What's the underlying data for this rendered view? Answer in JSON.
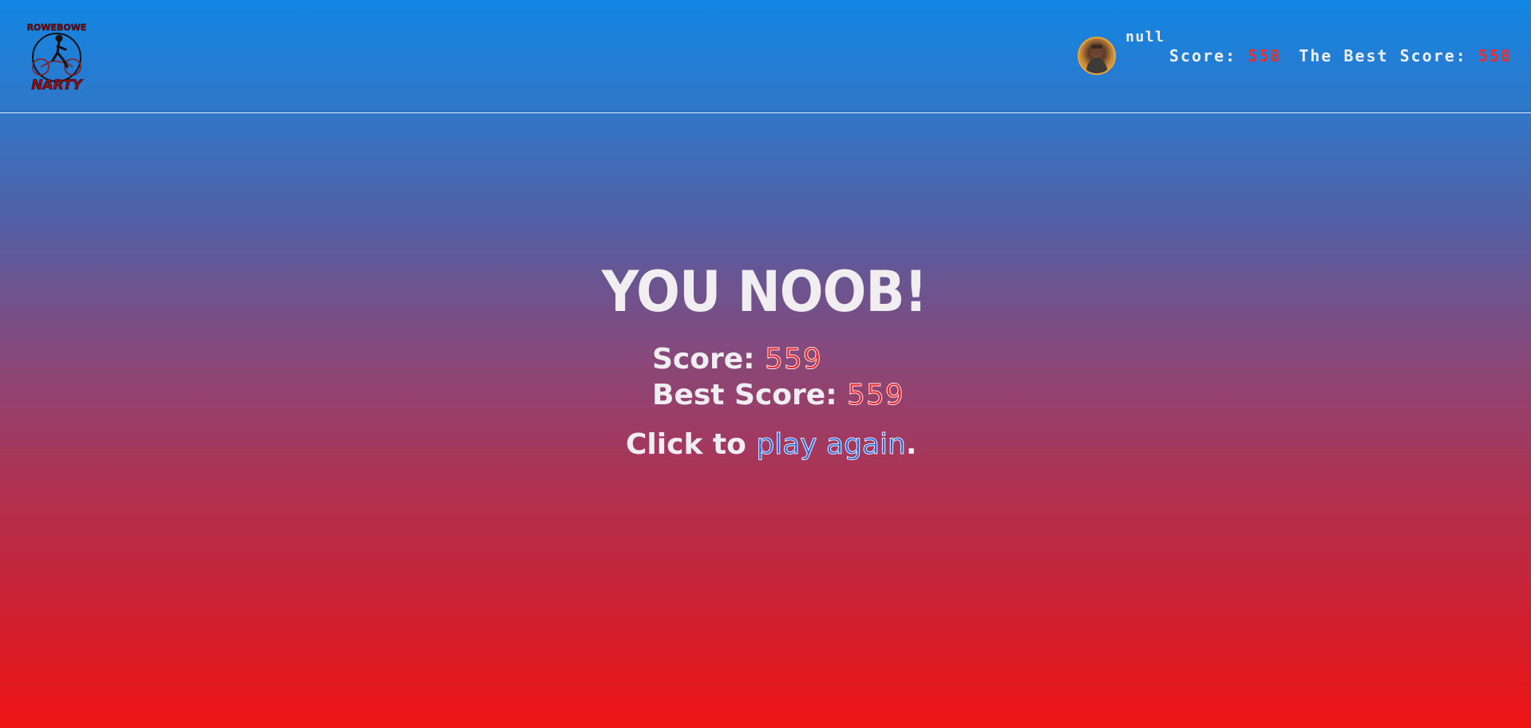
{
  "header": {
    "logo_text_top": "ROWEBOWE",
    "logo_text_bottom": "NARTY",
    "player_name": "null",
    "score_label": "Score: ",
    "score_value": "558",
    "best_label": "The Best Score: ",
    "best_value": "558"
  },
  "game_over": {
    "title": "YOU NOOB!",
    "score_label": "Score: ",
    "score_value": "559",
    "best_label": "Best Score: ",
    "best_value": "559",
    "again_prefix": "Click to ",
    "again_link": "play again",
    "again_suffix": "."
  },
  "colors": {
    "gradient_top": "#1286e2",
    "gradient_bottom": "#ef1313",
    "score_red": "#e8202a",
    "link_blue": "#2a62e0"
  },
  "icons": {
    "logo": "cyclist-logo-icon",
    "avatar": "player-avatar"
  }
}
